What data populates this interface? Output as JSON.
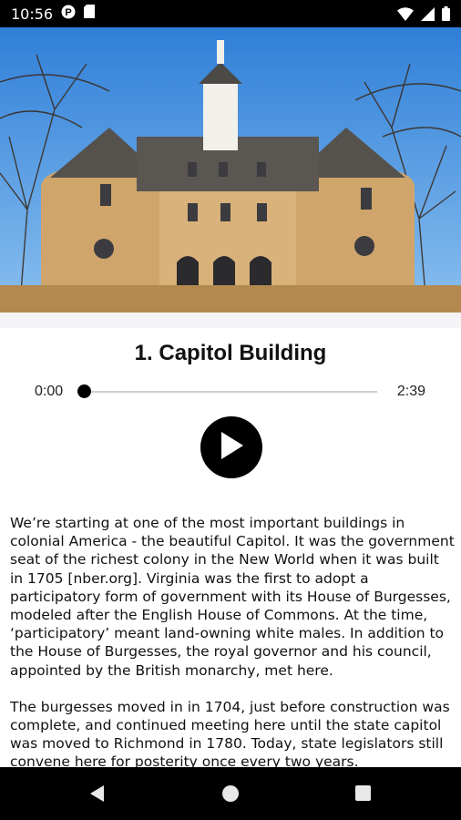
{
  "status_bar": {
    "time": "10:56",
    "icons": [
      "notification-p-icon",
      "sd-card-icon",
      "wifi-icon",
      "cell-signal-icon",
      "battery-icon"
    ]
  },
  "stop": {
    "title": "1. Capitol Building"
  },
  "player": {
    "current_time": "0:00",
    "duration": "2:39",
    "progress": 0.0,
    "state": "paused"
  },
  "description": {
    "paragraphs": [
      "We’re starting at one of the most important buildings in colonial America - the beautiful Capitol. It was the government seat of the richest colony in the New World when it was built in 1705 [nber.org]. Virginia was the first to adopt a participatory form of government with its House of Burgesses, modeled after the English House of Commons. At the time, ‘participatory’ meant land-owning white males. In addition to the House of Burgesses, the royal governor and his council, appointed by the British monarchy, met here.",
      "The burgesses moved in in 1704, just before construction was complete, and continued meeting here until the state capitol was moved to Richmond in 1780. Today, state legislators still convene here for posterity once every two years."
    ]
  },
  "colors": {
    "status_bar": "#000000",
    "nav_bar": "#000000",
    "accent": "#000000",
    "track": "#cfcfcf"
  }
}
